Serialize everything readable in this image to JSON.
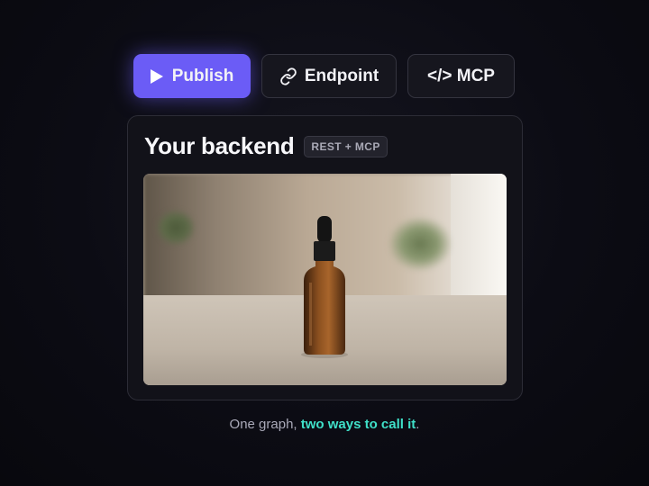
{
  "toolbar": {
    "publish_label": "Publish",
    "endpoint_label": "Endpoint",
    "mcp_label": "</> MCP",
    "publish_icon": "play-icon",
    "endpoint_icon": "link-icon"
  },
  "card": {
    "title": "Your backend",
    "badge": "REST + MCP"
  },
  "caption": {
    "prefix": "One graph, ",
    "highlight": "two ways to call it",
    "suffix": "."
  },
  "colors": {
    "accent": "#6b5cf6",
    "highlight": "#3fe0c8",
    "background": "#0c0c14"
  }
}
